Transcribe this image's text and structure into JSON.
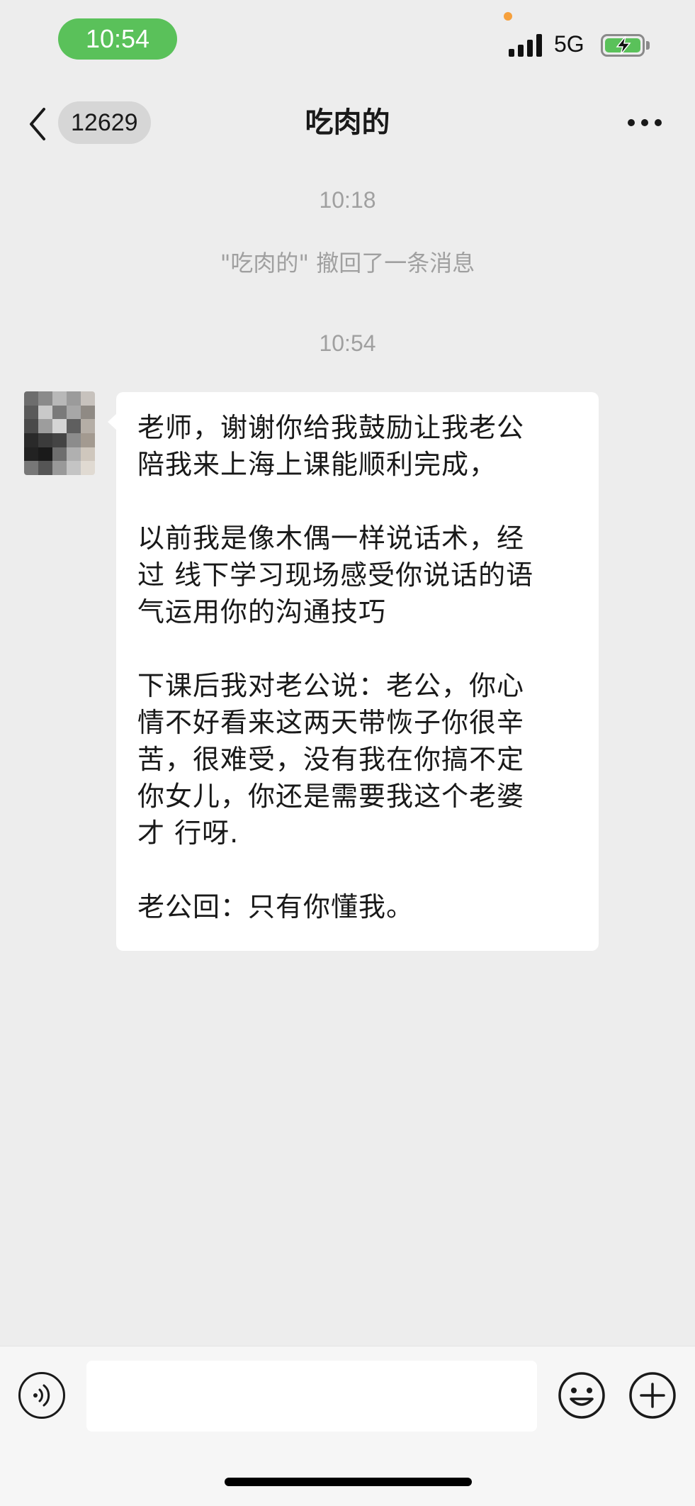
{
  "status_bar": {
    "time": "10:54",
    "network": "5G"
  },
  "nav": {
    "unread_count": "12629",
    "chat_title": "吃肉的"
  },
  "messages": {
    "time_1": "10:18",
    "recall_notice": "\"吃肉的\" 撤回了一条消息",
    "time_2": "10:54",
    "bubble": {
      "para_1": "老师，谢谢你给我鼓励让我老公\n陪我来上海上课能顺利完成，",
      "para_2": "以前我是像木偶一样说话术，经\n过 线下学习现场感受你说话的语\n气运用你的沟通技巧",
      "para_3": "下课后我对老公说：老公，你心\n情不好看来这两天带恢子你很辛\n苦，很难受，没有我在你搞不定\n你女儿，你还是需要我这个老婆\n才 行呀.",
      "para_4": "老公回：只有你懂我。"
    }
  },
  "input_bar": {
    "placeholder": ""
  },
  "colors": {
    "background": "#ededed",
    "time_pill": "#5ac15a",
    "bubble": "#ffffff",
    "system_text": "#a0a0a0"
  },
  "icons": [
    "back-arrow-icon",
    "more-icon",
    "voice-icon",
    "emoji-icon",
    "plus-icon",
    "signal-icon",
    "battery-charging-icon"
  ]
}
